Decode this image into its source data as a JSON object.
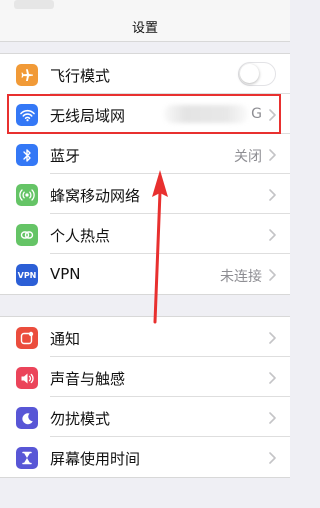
{
  "nav": {
    "title": "设置"
  },
  "group1": [
    {
      "label": "飞行模式",
      "icon": "airplane-icon",
      "color": "#f19a37",
      "control": "toggle",
      "toggle_on": false
    },
    {
      "label": "无线局域网",
      "icon": "wifi-icon",
      "color": "#3478f6",
      "value": "G",
      "value_redacted": true
    },
    {
      "label": "蓝牙",
      "icon": "bluetooth-icon",
      "color": "#3478f6",
      "value": "关闭"
    },
    {
      "label": "蜂窝移动网络",
      "icon": "cellular-icon",
      "color": "#65c466"
    },
    {
      "label": "个人热点",
      "icon": "hotspot-icon",
      "color": "#65c466"
    },
    {
      "label": "VPN",
      "icon": "vpn-icon",
      "icon_text": "VPN",
      "color": "#2c5fd6",
      "value": "未连接"
    }
  ],
  "group2": [
    {
      "label": "通知",
      "icon": "notifications-icon",
      "color": "#eb4d3d"
    },
    {
      "label": "声音与触感",
      "icon": "sound-icon",
      "color": "#eb445a"
    },
    {
      "label": "勿扰模式",
      "icon": "moon-icon",
      "color": "#5856d6"
    },
    {
      "label": "屏幕使用时间",
      "icon": "hourglass-icon",
      "color": "#5856d6"
    }
  ],
  "annotation": {
    "highlight_color": "#e8302f",
    "arrow_color": "#e8302f"
  }
}
